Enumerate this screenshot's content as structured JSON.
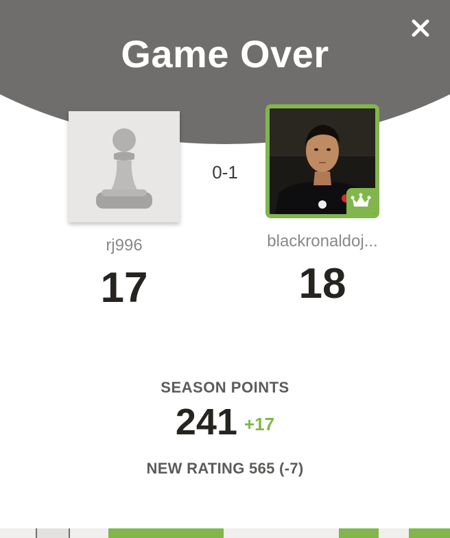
{
  "dialog": {
    "title": "Game Over",
    "close_icon": "close-icon",
    "result": "0-1"
  },
  "players": {
    "left": {
      "username": "rj996",
      "score": "17",
      "avatar_icon": "pawn-icon"
    },
    "right": {
      "username": "blackronaldoj...",
      "score": "18",
      "winner_icon": "crown-icon"
    }
  },
  "season": {
    "label": "SEASON POINTS",
    "points": "241",
    "delta": "+17"
  },
  "rating": {
    "text": "NEW RATING 565 (-7)"
  },
  "colors": {
    "header": "#6f6e6c",
    "accent_green": "#81b64c",
    "text_dark": "#262421",
    "text_muted": "#8b8987"
  }
}
